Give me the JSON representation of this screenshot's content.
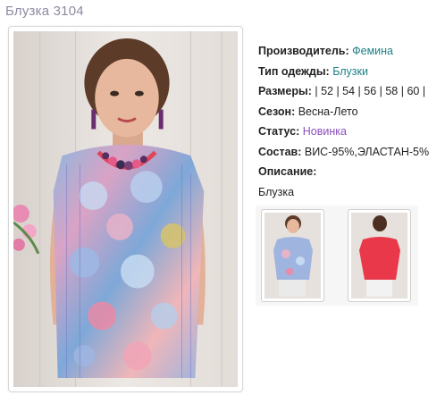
{
  "product": {
    "title": "Блузка 3104"
  },
  "details": {
    "manufacturer_label": "Производитель:",
    "manufacturer_value": "Фемина",
    "type_label": "Тип одежды:",
    "type_value": "Блузки",
    "sizes_label": "Размеры:",
    "sizes_value": "| 52 | 54 | 56 | 58 | 60 |",
    "season_label": "Сезон:",
    "season_value": "Весна-Лето",
    "status_label": "Статус:",
    "status_value": "Новинка",
    "composition_label": "Состав:",
    "composition_value": "ВИС-95%,ЭЛАСТАН-5%",
    "description_label": "Описание:",
    "description_value": "Блузка"
  },
  "colors": {
    "title": "#8d8aa0",
    "link": "#1d7f86",
    "status": "#8d4fbd",
    "back_top": "#e8384a"
  }
}
